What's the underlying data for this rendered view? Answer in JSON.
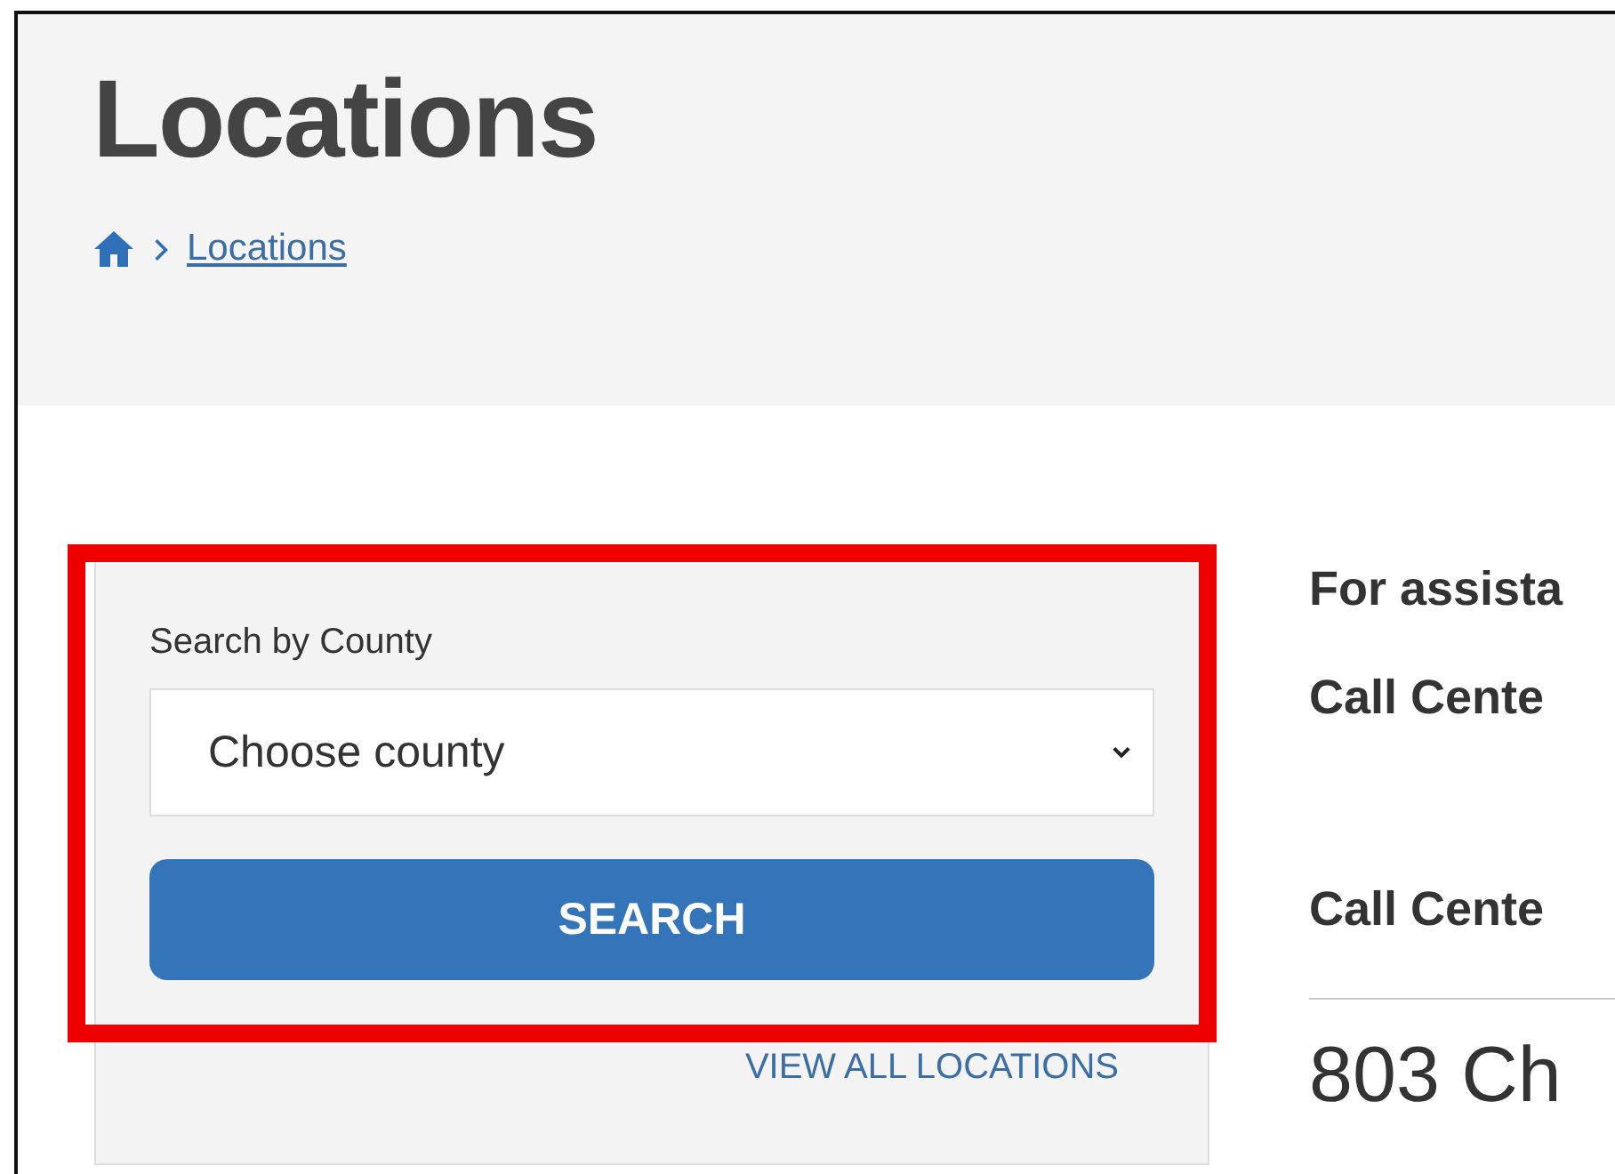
{
  "header": {
    "title": "Locations",
    "breadcrumb": [
      {
        "label": "Locations"
      }
    ]
  },
  "search_panel": {
    "label": "Search by County",
    "select": {
      "value": "Choose county"
    },
    "button": "SEARCH",
    "link": "VIEW ALL LOCATIONS",
    "highlighted": true
  },
  "info": {
    "lines": [
      "For assista",
      "Call Cente",
      "Call Cente"
    ],
    "address": "803 Ch"
  }
}
